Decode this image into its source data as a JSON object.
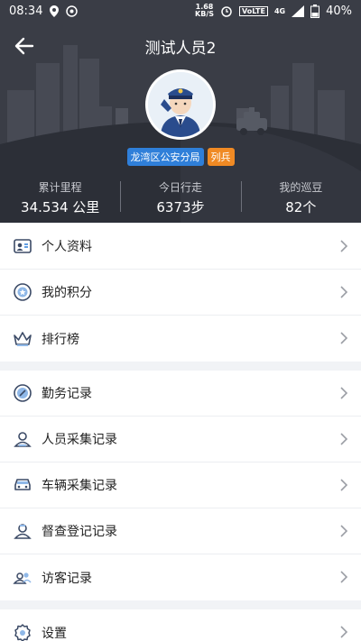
{
  "status": {
    "time": "08:34",
    "speed_value": "1.68",
    "speed_unit": "KB/S",
    "volte": "VoLTE",
    "network": "4G",
    "battery": "40%"
  },
  "header": {
    "title": "测试人员2",
    "department": "龙湾区公安分局",
    "rank": "列兵"
  },
  "stats": [
    {
      "label": "累计里程",
      "value": "34.534 公里"
    },
    {
      "label": "今日行走",
      "value": "6373步"
    },
    {
      "label": "我的巡豆",
      "value": "82个"
    }
  ],
  "menu": {
    "group1": [
      {
        "label": "个人资料",
        "icon": "profile-card-icon"
      },
      {
        "label": "我的积分",
        "icon": "points-icon"
      },
      {
        "label": "排行榜",
        "icon": "crown-icon"
      }
    ],
    "group2": [
      {
        "label": "勤务记录",
        "icon": "duty-icon"
      },
      {
        "label": "人员采集记录",
        "icon": "person-icon"
      },
      {
        "label": "车辆采集记录",
        "icon": "car-icon"
      },
      {
        "label": "督查登记记录",
        "icon": "inspector-icon"
      },
      {
        "label": "访客记录",
        "icon": "visitor-icon"
      }
    ],
    "group3": [
      {
        "label": "设置",
        "icon": "gear-icon"
      }
    ]
  },
  "colors": {
    "header_bg": "#3a3d46",
    "accent_blue": "#2f7fd9",
    "rank_orange": "#f08a24"
  }
}
